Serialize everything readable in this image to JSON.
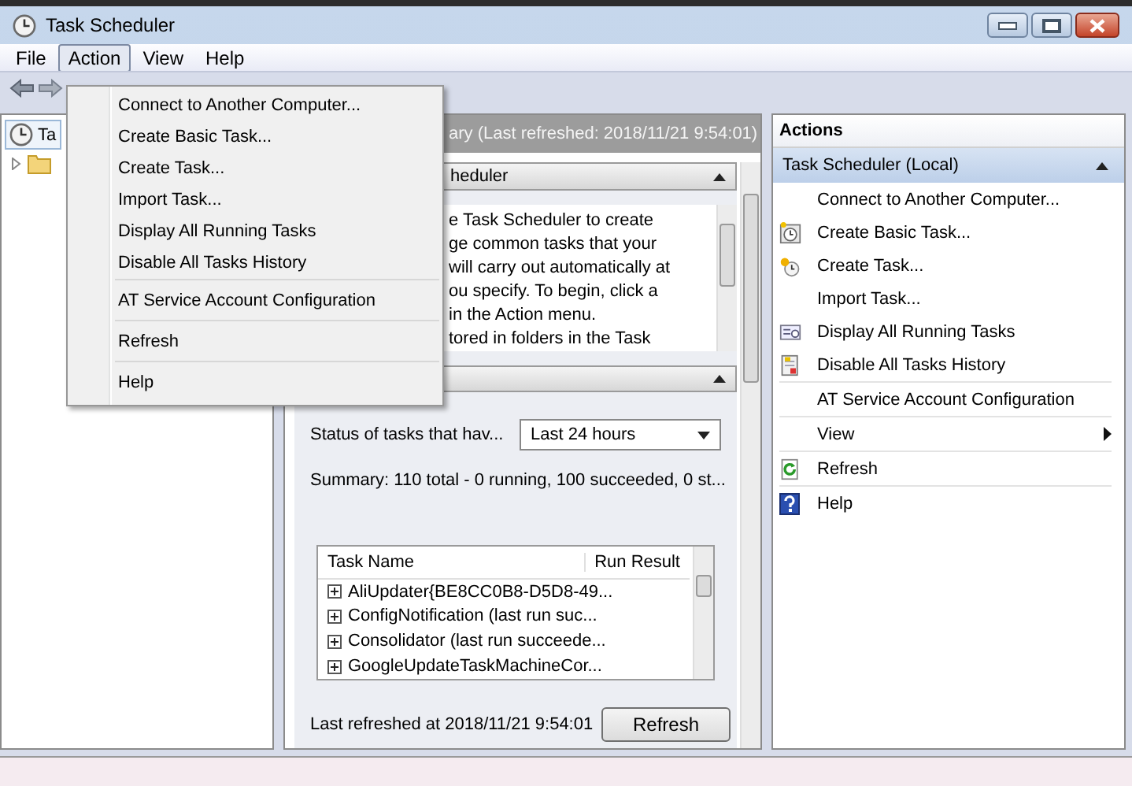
{
  "window": {
    "title": "Task Scheduler"
  },
  "menu_bar": [
    {
      "label": "File",
      "selected": false
    },
    {
      "label": "Action",
      "selected": true
    },
    {
      "label": "View",
      "selected": false
    },
    {
      "label": "Help",
      "selected": false
    }
  ],
  "tree": [
    {
      "label": "Ta",
      "children": [
        {
          "expanded": false
        }
      ]
    }
  ],
  "summary_header": "ary (Last refreshed: 2018/11/21 9:54:01)",
  "overview_section": {
    "title": "heduler",
    "lines": [
      "e Task Scheduler to create",
      "ge common tasks that your",
      "will carry out automatically at",
      "ou specify. To begin, click a",
      "in the Action menu.",
      "tored in folders in the Task"
    ]
  },
  "status_section": {
    "filter_label": "Status of tasks that hav...",
    "filter_value": "Last 24 hours",
    "summary": "Summary: 110 total - 0 running, 100 succeeded, 0 st...",
    "table": {
      "columns": [
        "Task Name",
        "Run Result"
      ],
      "rows": [
        "AliUpdater{BE8CC0B8-D5D8-49...",
        "ConfigNotification (last run suc...",
        "Consolidator (last run succeede...",
        "GoogleUpdateTaskMachineCor..."
      ]
    },
    "last_refreshed": "Last refreshed at 2018/11/21 9:54:01",
    "refresh_button": "Refresh"
  },
  "actions": {
    "title": "Actions",
    "group": "Task Scheduler (Local)",
    "items": [
      {
        "label": "Connect to Another Computer...",
        "kind": "plain",
        "separator_before": false
      },
      {
        "label": "Create Basic Task...",
        "kind": "wizard",
        "separator_before": false
      },
      {
        "label": "Create Task...",
        "kind": "task",
        "separator_before": false
      },
      {
        "label": "Import Task...",
        "kind": "plain",
        "separator_before": false
      },
      {
        "label": "Display All Running Tasks",
        "kind": "running",
        "separator_before": false
      },
      {
        "label": "Disable All Tasks History",
        "kind": "history",
        "separator_before": false
      },
      {
        "label": "AT Service Account Configuration",
        "kind": "plain",
        "separator_before": true
      },
      {
        "label": "View",
        "kind": "submenu",
        "separator_before": true
      },
      {
        "label": "Refresh",
        "kind": "refresh",
        "separator_before": true
      },
      {
        "label": "Help",
        "kind": "help",
        "separator_before": true
      }
    ]
  },
  "action_menu": [
    {
      "label": "Connect to Another Computer...",
      "separator_before": false
    },
    {
      "label": "Create Basic Task...",
      "separator_before": false
    },
    {
      "label": "Create Task...",
      "separator_before": false
    },
    {
      "label": "Import Task...",
      "separator_before": false
    },
    {
      "label": "Display All Running Tasks",
      "separator_before": false
    },
    {
      "label": "Disable All Tasks History",
      "separator_before": false
    },
    {
      "label": "AT Service Account Configuration",
      "separator_before": true
    },
    {
      "label": "Refresh",
      "separator_before": true
    },
    {
      "label": "Help",
      "separator_before": true
    }
  ]
}
